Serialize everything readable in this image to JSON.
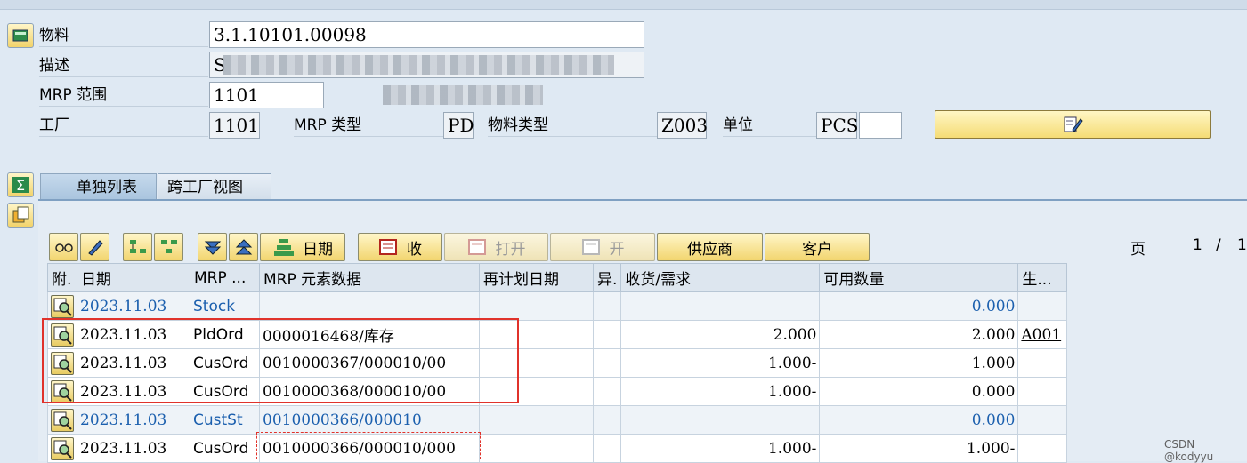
{
  "header": {
    "material_label": "物料",
    "material_value": "3.1.10101.00098",
    "desc_label": "描述",
    "desc_value": "S",
    "mrp_area_label": "MRP 范围",
    "mrp_area_value": "1101",
    "plant_label": "工厂",
    "plant_value": "1101",
    "mrp_type_label": "MRP 类型",
    "mrp_type_value": "PD",
    "material_type_label": "物料类型",
    "material_type_value": "Z003",
    "unit_label": "单位",
    "unit_value": "PCS",
    "unit_extra_value": ""
  },
  "tabs": [
    {
      "label": "单独列表",
      "active": true
    },
    {
      "label": "跨工厂视图",
      "active": false
    }
  ],
  "toolbar": {
    "date_label": "日期",
    "receipt_label": "收",
    "open_label": "打开",
    "open2_label": "开",
    "vendor_label": "供应商",
    "customer_label": "客户"
  },
  "pager": {
    "page_label": "页",
    "current": "1",
    "separator": "/",
    "total": "1"
  },
  "table": {
    "columns": [
      "附.",
      "日期",
      "MRP ...",
      "MRP 元素数据",
      "再计划日期",
      "异.",
      "收货/需求",
      "可用数量",
      "生..."
    ],
    "rows": [
      {
        "date": "2023.11.03",
        "mrp": "Stock",
        "element": "",
        "resched": "",
        "exc": "",
        "rec_req": "",
        "avail": "0.000",
        "prod": "",
        "style": "blue"
      },
      {
        "date": "2023.11.03",
        "mrp": "PldOrd",
        "element": "0000016468/库存",
        "resched": "",
        "exc": "",
        "rec_req": "2.000",
        "avail": "2.000",
        "prod": "A001",
        "style": "normal"
      },
      {
        "date": "2023.11.03",
        "mrp": "CusOrd",
        "element": "0010000367/000010/00",
        "resched": "",
        "exc": "",
        "rec_req": "1.000-",
        "avail": "1.000",
        "prod": "",
        "style": "normal"
      },
      {
        "date": "2023.11.03",
        "mrp": "CusOrd",
        "element": "0010000368/000010/00",
        "resched": "",
        "exc": "",
        "rec_req": "1.000-",
        "avail": "0.000",
        "prod": "",
        "style": "normal"
      },
      {
        "date": "2023.11.03",
        "mrp": "CustSt",
        "element": "0010000366/000010",
        "resched": "",
        "exc": "",
        "rec_req": "",
        "avail": "0.000",
        "prod": "",
        "style": "blue"
      },
      {
        "date": "2023.11.03",
        "mrp": "CusOrd",
        "element": "0010000366/000010/000",
        "resched": "",
        "exc": "",
        "rec_req": "1.000-",
        "avail": "1.000-",
        "prod": "",
        "style": "normal"
      }
    ]
  },
  "credit": "CSDN @kodyyu",
  "colors": {
    "background": "#dfe9f3",
    "button_yellow": "#f2d36b",
    "blue_text": "#1b5fae",
    "highlight_red": "#e0322b"
  }
}
